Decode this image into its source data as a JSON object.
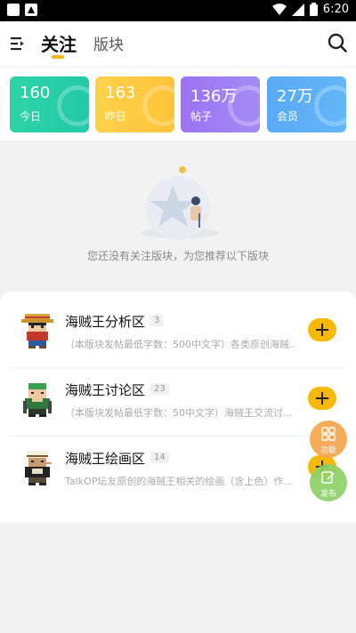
{
  "statusbar": {
    "time": "6:20"
  },
  "header": {
    "tab_follow": "关注",
    "tab_board": "版块"
  },
  "stats": [
    {
      "num": "160",
      "label": "今日"
    },
    {
      "num": "163",
      "label": "昨日"
    },
    {
      "num": "136万",
      "label": "帖子"
    },
    {
      "num": "27万",
      "label": "会员"
    }
  ],
  "empty": {
    "text": "您还没有关注版块，为您推荐以下版块"
  },
  "boards": [
    {
      "title": "海贼王分析区",
      "count": "3",
      "desc": "（本版块发帖最低字数：500中文字）各类原创海贼..."
    },
    {
      "title": "海贼王讨论区",
      "count": "23",
      "desc": "（本版块发帖最低字数：50中文字）海贼王交流讨..."
    },
    {
      "title": "海贼王绘画区",
      "count": "14",
      "desc": "TalkOP坛友原创的海贼王相关的绘画（含上色）作..."
    }
  ],
  "fab": {
    "function_label": "功能",
    "post_label": "发布"
  },
  "colors": {
    "accent": "#f5b800",
    "today": "#2ed3a5",
    "yesterday": "#ffc33a",
    "posts": "#9b72f2",
    "members": "#59a9f6"
  }
}
